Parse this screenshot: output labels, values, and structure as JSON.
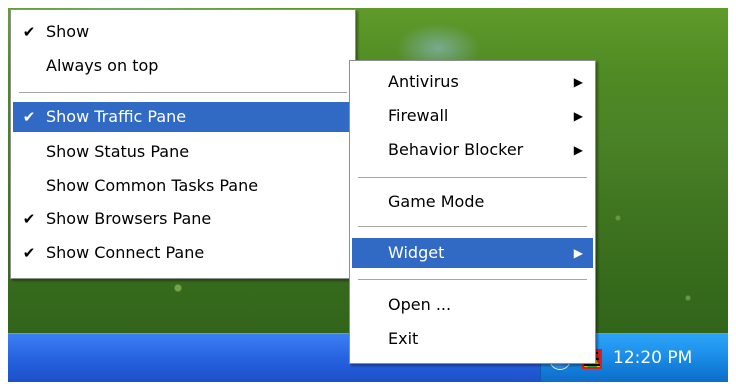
{
  "left_menu": {
    "items": [
      {
        "label": "Show",
        "checked": true
      },
      {
        "label": "Always on top",
        "checked": false
      },
      {
        "label": "Show Traffic Pane",
        "checked": true,
        "highlighted": true
      },
      {
        "label": "Show Status Pane",
        "checked": false
      },
      {
        "label": "Show Common Tasks Pane",
        "checked": false
      },
      {
        "label": "Show Browsers Pane",
        "checked": true
      },
      {
        "label": "Show Connect Pane",
        "checked": true
      }
    ]
  },
  "right_menu": {
    "items": [
      {
        "label": "Antivirus",
        "submenu": true
      },
      {
        "label": "Firewall",
        "submenu": true
      },
      {
        "label": "Behavior Blocker",
        "submenu": true
      },
      {
        "label": "Game Mode",
        "submenu": false
      },
      {
        "label": "Widget",
        "submenu": true,
        "highlighted": true
      },
      {
        "label": "Open ...",
        "submenu": false
      },
      {
        "label": "Exit",
        "submenu": false
      }
    ]
  },
  "taskbar": {
    "clock": "12:20 PM",
    "tray_icons": [
      "show-hidden-icons-icon",
      "security-app-tray-icon"
    ]
  },
  "glyphs": {
    "check": "✔",
    "submenu_arrow": "▶",
    "expand": "«"
  },
  "colors": {
    "menu_highlight": "#316ac5",
    "taskbar": "#245edb",
    "tray": "#1f93ee"
  }
}
